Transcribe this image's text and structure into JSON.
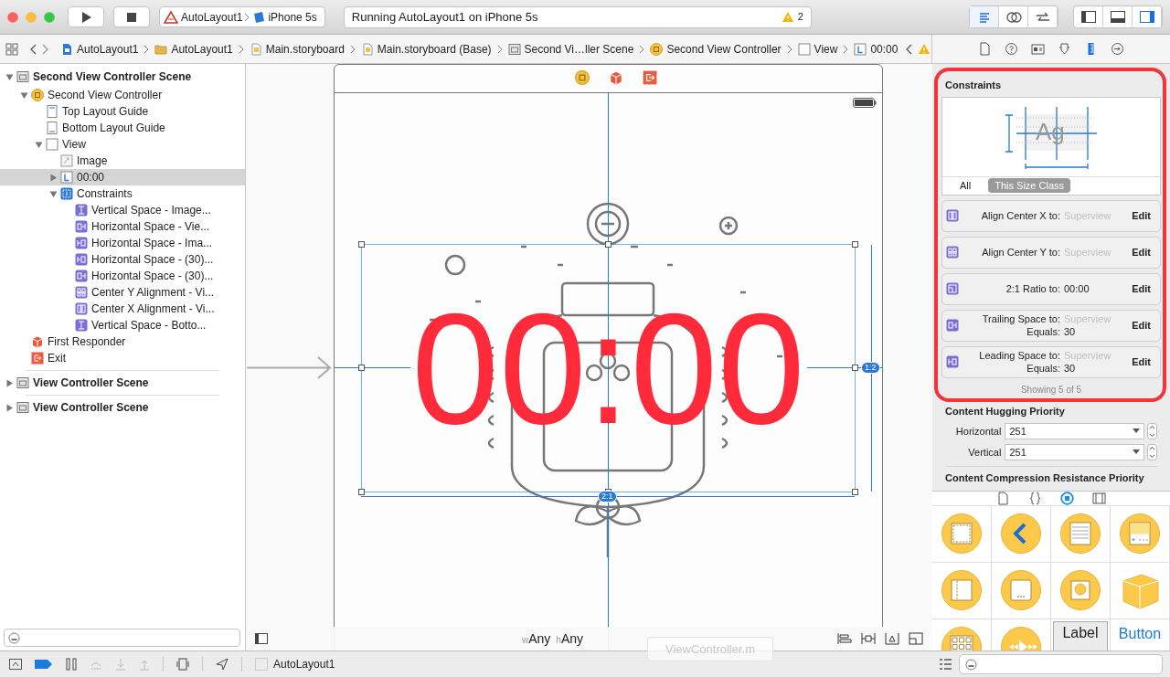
{
  "toolbar": {
    "scheme": "AutoLayout1",
    "destination": "iPhone 5s",
    "status": "Running AutoLayout1 on iPhone 5s",
    "warning_count": "2",
    "editor_modes": [
      {
        "kind": "standard",
        "selected": true
      },
      {
        "kind": "assistant",
        "selected": false
      },
      {
        "kind": "version",
        "selected": false
      }
    ],
    "panels": [
      {
        "kind": "navigator",
        "selected": false
      },
      {
        "kind": "debug",
        "selected": false
      },
      {
        "kind": "utilities",
        "selected": true
      }
    ]
  },
  "breadcrumbs": [
    {
      "kind": "project",
      "label": "AutoLayout1"
    },
    {
      "kind": "folder",
      "label": "AutoLayout1"
    },
    {
      "kind": "storyboard",
      "label": "Main.storyboard"
    },
    {
      "kind": "storyboard",
      "label": "Main.storyboard (Base)"
    },
    {
      "kind": "scene",
      "label": "Second Vi…ller Scene"
    },
    {
      "kind": "view-controller",
      "label": "Second View Controller"
    },
    {
      "kind": "view",
      "label": "View"
    },
    {
      "kind": "label",
      "label": "00:00"
    }
  ],
  "inspector_tabs": [
    {
      "kind": "file",
      "selected": false
    },
    {
      "kind": "help",
      "selected": false
    },
    {
      "kind": "identity",
      "selected": false
    },
    {
      "kind": "attributes",
      "selected": false
    },
    {
      "kind": "size",
      "selected": true
    },
    {
      "kind": "connections",
      "selected": false
    }
  ],
  "outline": [
    {
      "kind": "scene",
      "label": "Second View Controller Scene",
      "bold": true,
      "expanded": true,
      "selected": false,
      "children": [
        {
          "kind": "view-controller",
          "label": "Second View Controller",
          "expanded": true,
          "selected": false,
          "children": [
            {
              "kind": "top-guide",
              "label": "Top Layout Guide",
              "selected": false
            },
            {
              "kind": "bottom-guide",
              "label": "Bottom Layout Guide",
              "selected": false
            },
            {
              "kind": "view",
              "label": "View",
              "expanded": true,
              "selected": false,
              "children": [
                {
                  "kind": "image",
                  "label": "Image",
                  "selected": false
                },
                {
                  "kind": "label",
                  "label": "00:00",
                  "expanded": false,
                  "selected": true
                },
                {
                  "kind": "constraints",
                  "label": "Constraints",
                  "expanded": true,
                  "selected": false,
                  "children": [
                    {
                      "kind": "vertical-space",
                      "label": "Vertical Space - Image...",
                      "selected": false
                    },
                    {
                      "kind": "trailing-space",
                      "label": "Horizontal Space - Vie...",
                      "selected": false
                    },
                    {
                      "kind": "leading-space",
                      "label": "Horizontal Space - Ima...",
                      "selected": false
                    },
                    {
                      "kind": "leading-space",
                      "label": "Horizontal Space - (30)...",
                      "selected": false
                    },
                    {
                      "kind": "trailing-space",
                      "label": "Horizontal Space - (30)...",
                      "selected": false
                    },
                    {
                      "kind": "center-y",
                      "label": "Center Y Alignment - Vi...",
                      "selected": false
                    },
                    {
                      "kind": "center-x",
                      "label": "Center X Alignment - Vi...",
                      "selected": false
                    },
                    {
                      "kind": "vertical-space",
                      "label": "Vertical Space - Botto...",
                      "selected": false
                    }
                  ]
                }
              ]
            }
          ]
        },
        {
          "kind": "first-responder",
          "label": "First Responder",
          "selected": false
        },
        {
          "kind": "exit",
          "label": "Exit",
          "selected": false
        }
      ]
    },
    {
      "kind": "scene",
      "label": "View Controller Scene",
      "bold": true,
      "expanded": false,
      "selected": false
    },
    {
      "kind": "scene",
      "label": "View Controller Scene",
      "bold": true,
      "expanded": false,
      "selected": false
    }
  ],
  "canvas": {
    "clock_text": "00:00",
    "height_badge": "1:2",
    "width_badge": "2:1",
    "size_class": {
      "w_prefix": "w",
      "w_value": "Any",
      "h_prefix": "h",
      "h_value": "Any"
    }
  },
  "tooltip": "ViewController.m",
  "constraints_panel": {
    "title": "Constraints",
    "preview_text": "Ag",
    "filters": [
      {
        "label": "All",
        "selected": false
      },
      {
        "label": "This Size Class",
        "selected": true
      }
    ],
    "rows": [
      {
        "kind": "center-x",
        "label": "Align Center X to:",
        "target": "Superview",
        "target_dimmed": true,
        "action": "Edit"
      },
      {
        "kind": "center-y",
        "label": "Align Center Y to:",
        "target": "Superview",
        "target_dimmed": true,
        "action": "Edit"
      },
      {
        "kind": "ratio",
        "label": "2:1 Ratio to:",
        "target": "00:00",
        "target_dimmed": false,
        "action": "Edit"
      },
      {
        "kind": "trailing-space",
        "label": "Trailing Space to:",
        "target": "Superview",
        "target_dimmed": true,
        "equals_label": "Equals:",
        "equals": "30",
        "action": "Edit"
      },
      {
        "kind": "leading-space",
        "label": "Leading Space to:",
        "target": "Superview",
        "target_dimmed": true,
        "equals_label": "Equals:",
        "equals": "30",
        "action": "Edit"
      }
    ],
    "summary": "Showing 5 of 5"
  },
  "content_hugging": {
    "title": "Content Hugging Priority",
    "rows": [
      {
        "label": "Horizontal",
        "value": "251"
      },
      {
        "label": "Vertical",
        "value": "251"
      }
    ]
  },
  "compression_title": "Content Compression Resistance Priority",
  "library": {
    "tabs": [
      {
        "kind": "file",
        "selected": false
      },
      {
        "kind": "braces",
        "selected": false
      },
      {
        "kind": "object",
        "selected": true
      },
      {
        "kind": "media",
        "selected": false
      }
    ],
    "items": [
      {
        "kind": "dashed-square"
      },
      {
        "kind": "chevron"
      },
      {
        "kind": "lined-sheet"
      },
      {
        "kind": "card-star"
      },
      {
        "kind": "split-panel"
      },
      {
        "kind": "sheet-dots"
      },
      {
        "kind": "circle-in-square"
      },
      {
        "kind": "cube"
      },
      {
        "kind": "grid"
      },
      {
        "kind": "playback"
      },
      {
        "kind": "text-label",
        "text": "Label"
      },
      {
        "kind": "text-button",
        "text": "Button"
      }
    ]
  },
  "debug_bar": {
    "target": "AutoLayout1"
  }
}
